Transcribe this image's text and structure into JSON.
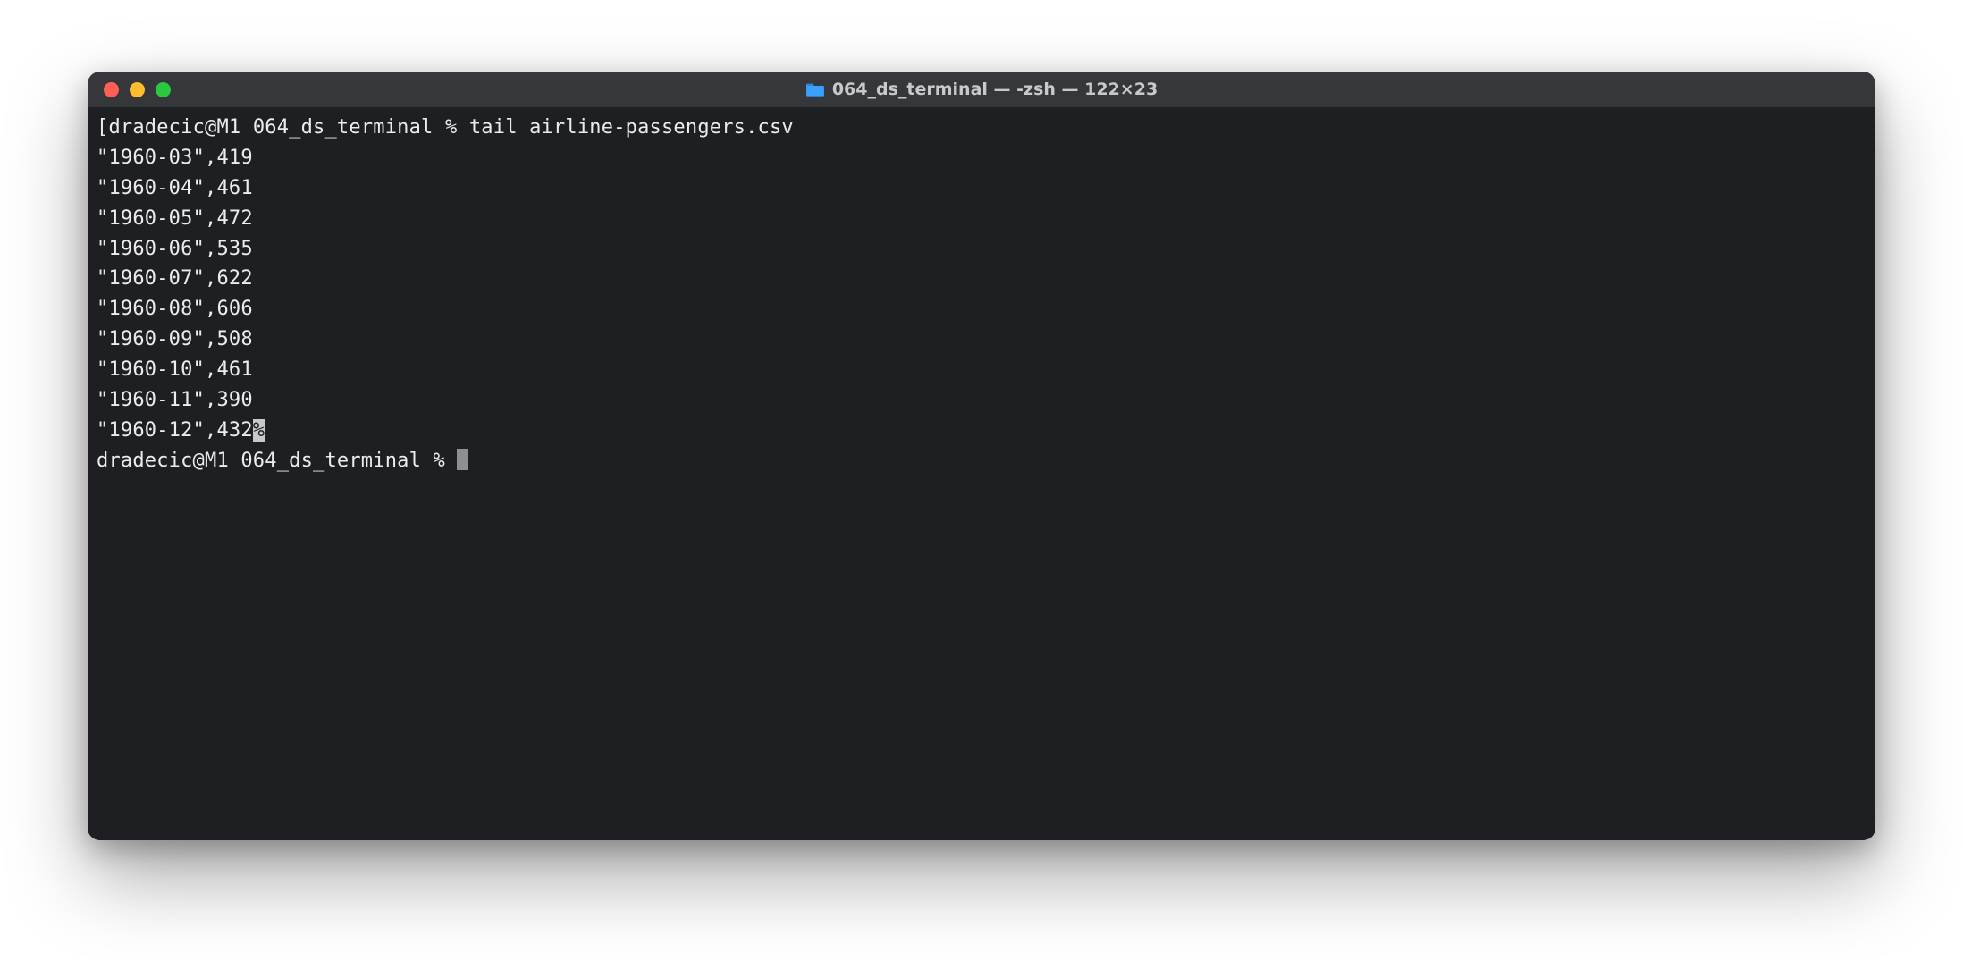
{
  "window": {
    "title": "064_ds_terminal — -zsh — 122×23",
    "folder_icon": "folder-icon"
  },
  "session": {
    "bracket_open": "[",
    "prompt1_user_host": "dradecic@M1",
    "prompt1_cwd": "064_ds_terminal",
    "prompt1_symbol": "%",
    "command": "tail airline-passengers.csv",
    "output_lines": [
      "\"1960-03\",419",
      "\"1960-04\",461",
      "\"1960-05\",472",
      "\"1960-06\",535",
      "\"1960-07\",622",
      "\"1960-08\",606",
      "\"1960-09\",508",
      "\"1960-10\",461",
      "\"1960-11\",390"
    ],
    "last_output_prefix": "\"1960-12\",432",
    "eof_char": "%",
    "prompt2_user_host": "dradecic@M1",
    "prompt2_cwd": "064_ds_terminal",
    "prompt2_symbol": "%"
  }
}
